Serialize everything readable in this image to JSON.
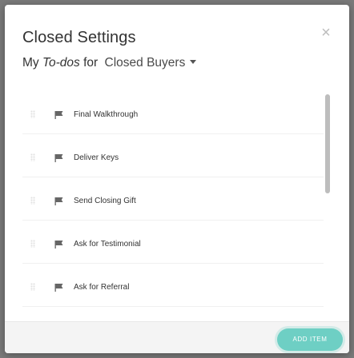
{
  "modal": {
    "title": "Closed Settings",
    "close_symbol": "×"
  },
  "subtitle": {
    "prefix": "My",
    "italic": "To-dos",
    "for_word": "for",
    "selected_option": "Closed Buyers"
  },
  "todos": [
    {
      "label": "Final Walkthrough",
      "icon": "flag-icon"
    },
    {
      "label": "Deliver Keys",
      "icon": "flag-icon"
    },
    {
      "label": "Send Closing Gift",
      "icon": "flag-icon"
    },
    {
      "label": "Ask for Testimonial",
      "icon": "flag-icon"
    },
    {
      "label": "Ask for Referral",
      "icon": "flag-icon"
    }
  ],
  "footer": {
    "add_item_label": "ADD ITEM"
  },
  "colors": {
    "accent": "#6ecfc4",
    "text": "#333333",
    "icon": "#666666",
    "overlay": "#7a7a7a"
  }
}
